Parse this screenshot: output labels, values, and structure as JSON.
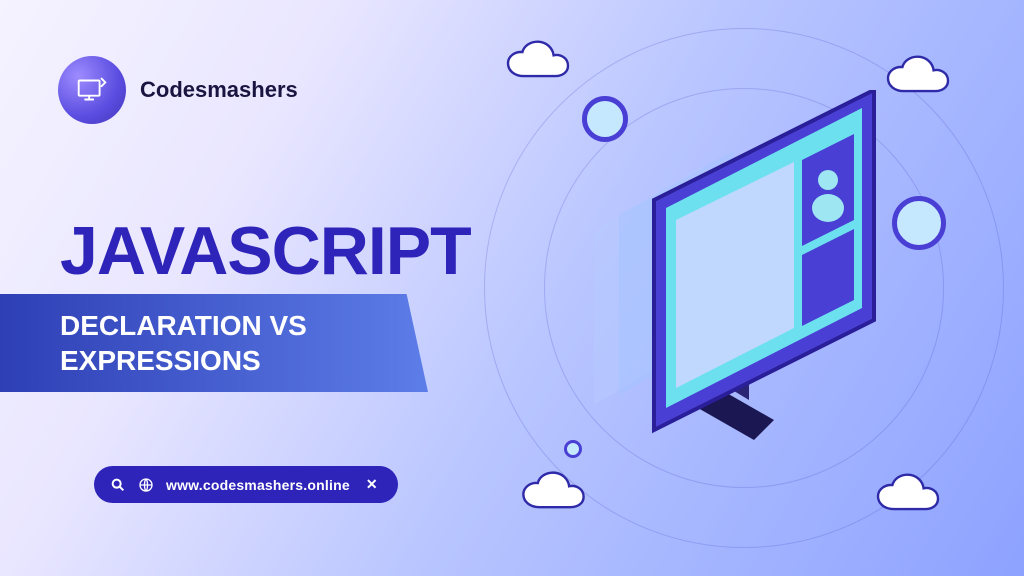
{
  "brand": {
    "name": "Codesmashers"
  },
  "headline": "JAVASCRIPT",
  "subtitle": "DECLARATION VS EXPRESSIONS",
  "url_pill": {
    "url": "www.codesmashers.online",
    "close_symbol": "✕"
  },
  "illustration": {
    "clouds": 4,
    "orbits": 2,
    "nodes": 3
  },
  "colors": {
    "primary": "#2e24b9",
    "gradient_start": "#f5f3ff",
    "gradient_end": "#8da2ff"
  }
}
